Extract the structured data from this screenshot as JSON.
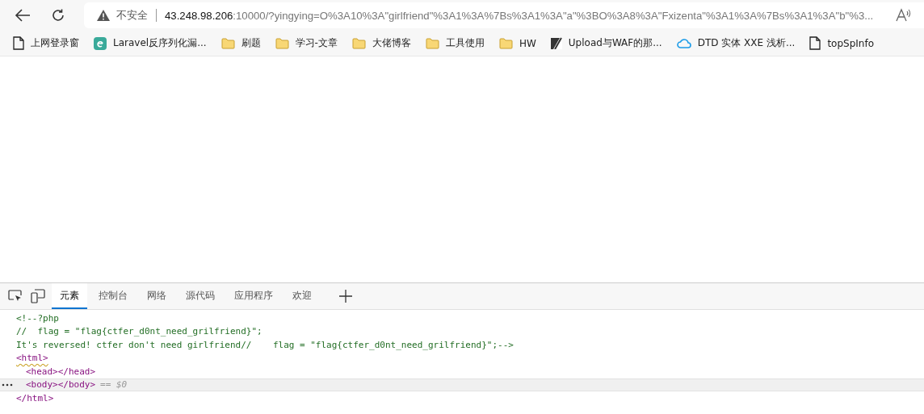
{
  "toolbar": {
    "security_label": "不安全",
    "url_host": "43.248.98.206",
    "url_rest": ":10000/?yingying=O%3A10%3A\"girlfriend\"%3A1%3A%7Bs%3A1%3A\"a\"%3BO%3A8%3A\"Fxizenta\"%3A1%3A%7Bs%3A1%3A\"b\"%3..."
  },
  "bookmarks": [
    {
      "label": "上网登录窗",
      "kind": "page"
    },
    {
      "label": "Laravel反序列化漏...",
      "kind": "app"
    },
    {
      "label": "刷题",
      "kind": "folder"
    },
    {
      "label": "学习-文章",
      "kind": "folder"
    },
    {
      "label": "大佬博客",
      "kind": "folder"
    },
    {
      "label": "工具使用",
      "kind": "folder"
    },
    {
      "label": "HW",
      "kind": "folder"
    },
    {
      "label": "Upload与WAF的那...",
      "kind": "logo"
    },
    {
      "label": "DTD 实体 XXE 浅析...",
      "kind": "cloud"
    },
    {
      "label": "topSpInfo",
      "kind": "page"
    }
  ],
  "devtools": {
    "tabs": [
      {
        "label": "元素",
        "selected": true
      },
      {
        "label": "控制台",
        "selected": false
      },
      {
        "label": "网络",
        "selected": false
      },
      {
        "label": "源代码",
        "selected": false
      },
      {
        "label": "应用程序",
        "selected": false
      },
      {
        "label": "欢迎",
        "selected": false
      }
    ],
    "dom": [
      {
        "kind": "comment",
        "text": "<!--?php"
      },
      {
        "kind": "comment",
        "text": "//  flag = \"flag{ctfer_d0nt_need_grilfriend}\";"
      },
      {
        "kind": "comment",
        "text": "It's reversed! ctfer don't need girlfriend//    flag = \"flag{ctfer_d0nt_need_grilfriend}\";-->"
      },
      {
        "kind": "tag",
        "text": "<html>",
        "selected": false,
        "children": [
          {
            "kind": "tag",
            "text": "<head></head>",
            "selected": false
          },
          {
            "kind": "tag",
            "text": "<body></body>",
            "selected": true,
            "suffix": "== $0"
          }
        ]
      },
      {
        "kind": "tag",
        "text": "</html>",
        "selected": false
      }
    ]
  }
}
